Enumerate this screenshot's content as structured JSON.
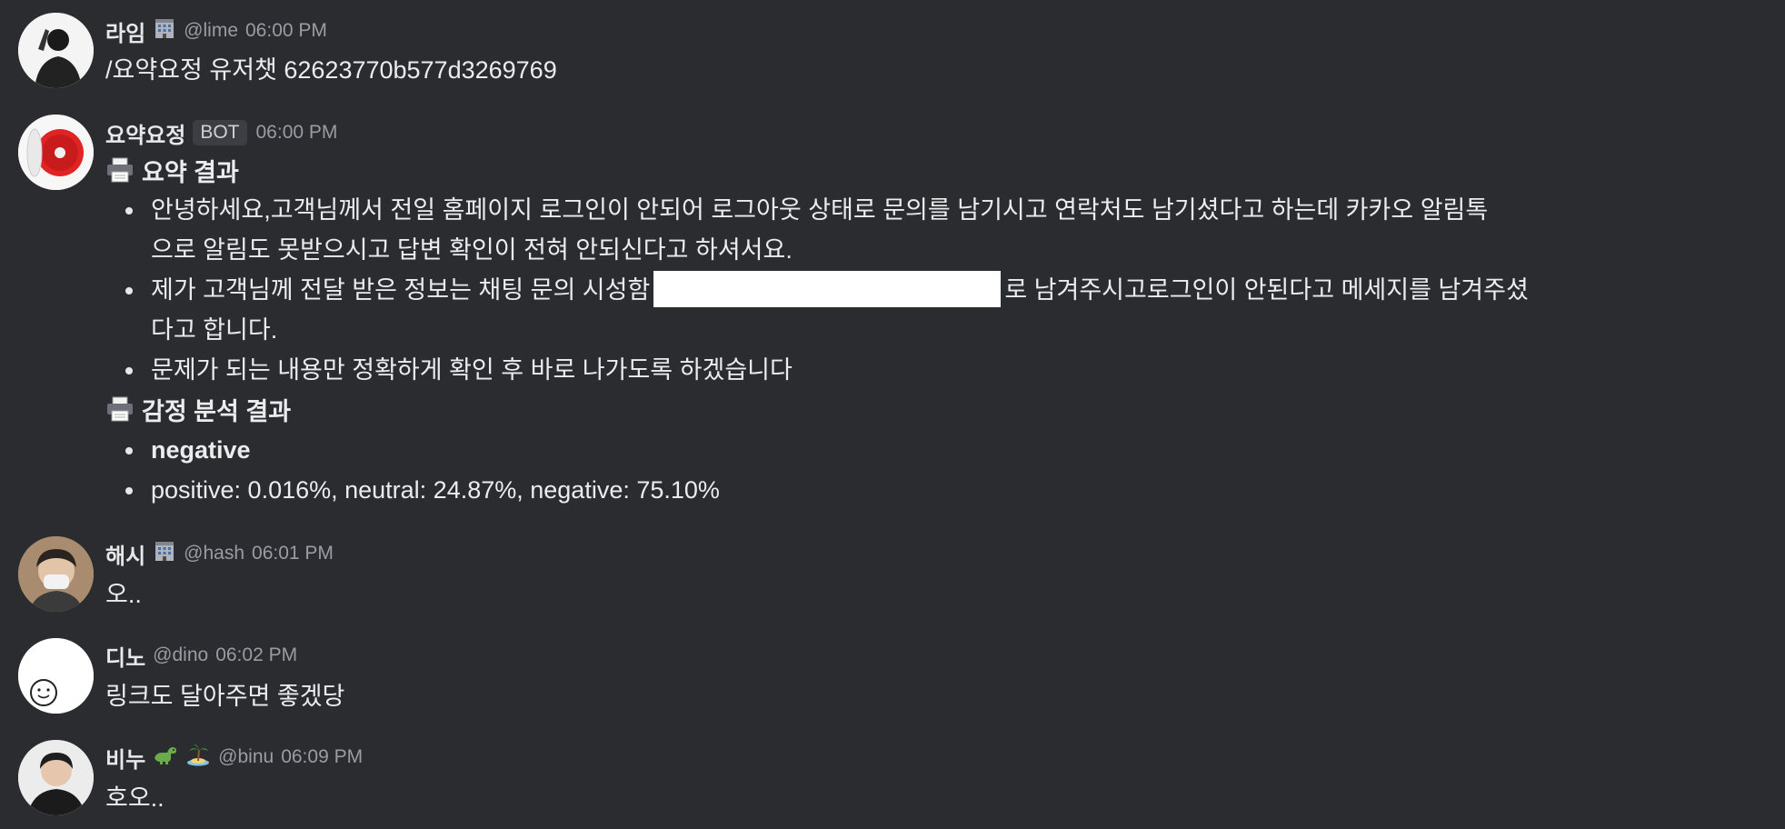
{
  "messages": {
    "m1": {
      "name": "라임",
      "handle": "@lime",
      "time": "06:00 PM",
      "text": "/요약요정 유저챗 62623770b577d3269769"
    },
    "m2": {
      "name": "요약요정",
      "tag": "BOT",
      "time": "06:00 PM",
      "summary_title": "요약 결과",
      "summary_items": [
        {
          "line1": "안녕하세요,고객님께서 전일 홈페이지 로그인이 안되어 로그아웃 상태로 문의를 남기시고 연락처도 남기셨다고 하는데 카카오 알림톡",
          "line2": "으로 알림도 못받으시고 답변 확인이 전혀 안되신다고 하셔서요."
        },
        {
          "before": "제가 고객님께 전달 받은 정보는 채팅 문의 시성함",
          "after": "로 남겨주시고로그인이 안된다고 메세지를 남겨주셨",
          "line2": "다고 합니다."
        },
        {
          "line1": "문제가 되는 내용만 정확하게 확인 후 바로 나가도록 하겠습니다"
        }
      ],
      "sentiment_title": "감정 분석 결과",
      "sentiment_label": "negative",
      "sentiment_scores": "positive: 0.016%, neutral: 24.87%, negative: 75.10%"
    },
    "m3": {
      "name": "해시",
      "handle": "@hash",
      "time": "06:01 PM",
      "text": "오.."
    },
    "m4": {
      "name": "디노",
      "handle": "@dino",
      "time": "06:02 PM",
      "text": "링크도 달아주면 좋겠당"
    },
    "m5": {
      "name": "비누",
      "handle": "@binu",
      "time": "06:09 PM",
      "text": "호오.."
    }
  },
  "icons": {
    "office": "office-building-icon",
    "printer": "printer-icon",
    "dinosaur": "dinosaur-icon",
    "island": "desert-island-icon"
  },
  "colors": {
    "background": "#2b2c30",
    "text": "#ececee",
    "muted": "#9b9ca3"
  }
}
